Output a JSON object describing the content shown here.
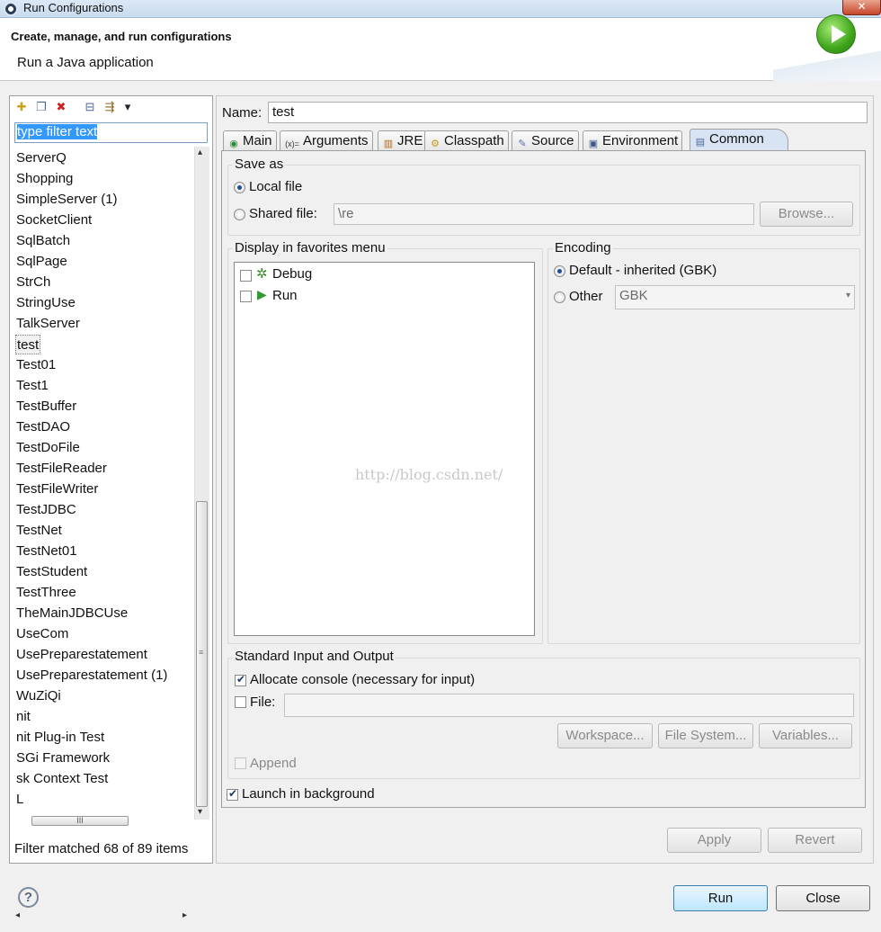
{
  "window": {
    "title": "Run Configurations",
    "close_glyph": "✕"
  },
  "header": {
    "title": "Create, manage, and run configurations",
    "subtitle": "Run a Java application",
    "icon": "run-large-icon"
  },
  "left": {
    "toolbar": [
      {
        "name": "new-config-icon",
        "glyph": "✚"
      },
      {
        "name": "duplicate-icon",
        "glyph": "❐"
      },
      {
        "name": "delete-icon",
        "glyph": "✖"
      },
      {
        "name": "collapse-all-icon",
        "glyph": "⊟"
      },
      {
        "name": "filter-icon",
        "glyph": "⇶"
      },
      {
        "name": "dropdown-arrow-icon",
        "glyph": "▾"
      }
    ],
    "filter_text": "type filter text",
    "items": [
      "ServerQ",
      "Shopping",
      "SimpleServer (1)",
      "SocketClient",
      "SqlBatch",
      "SqlPage",
      "StrCh",
      "StringUse",
      "TalkServer",
      "test",
      "Test01",
      "Test1",
      "TestBuffer",
      "TestDAO",
      "TestDoFile",
      "TestFileReader",
      "TestFileWriter",
      "TestJDBC",
      "TestNet",
      "TestNet01",
      "TestStudent",
      "TestThree",
      "TheMainJDBCUse",
      "UseCom",
      "UsePreparestatement",
      "UsePreparestatement (1)",
      "WuZiQi",
      "nit",
      "nit Plug-in Test",
      "SGi Framework",
      "sk Context Test",
      "L"
    ],
    "selected_index": 9,
    "hscroll_grip": "III",
    "scroll_up": "▴",
    "scroll_down": "▾",
    "scroll_left": "◂",
    "scroll_right": "▸",
    "filter_status": "Filter matched 68 of 89 items"
  },
  "right": {
    "name_label": "Name:",
    "name_value": "test",
    "tabs": [
      {
        "label": "Main",
        "icon": "main-tab-icon",
        "glyph": "◉",
        "color": "#2e8b3a"
      },
      {
        "label": "Arguments",
        "icon": "arguments-tab-icon",
        "glyph": "(x)=",
        "color": "#333333"
      },
      {
        "label": "JRE",
        "icon": "jre-tab-icon",
        "glyph": "▥",
        "color": "#b06a1a"
      },
      {
        "label": "Classpath",
        "icon": "classpath-tab-icon",
        "glyph": "⚙",
        "color": "#c49a1a"
      },
      {
        "label": "Source",
        "icon": "source-tab-icon",
        "glyph": "✎",
        "color": "#5a6fa5"
      },
      {
        "label": "Environment",
        "icon": "environment-tab-icon",
        "glyph": "▣",
        "color": "#3a5a8a"
      },
      {
        "label": "Common",
        "icon": "common-tab-icon",
        "glyph": "▤",
        "color": "#4a6a9a"
      }
    ],
    "active_tab": 6,
    "save_as": {
      "title": "Save as",
      "local_file": "Local file",
      "shared_file": "Shared file:",
      "shared_value": "\\re",
      "browse": "Browse..."
    },
    "favorites": {
      "title": "Display in favorites menu",
      "items": [
        {
          "label": "Debug",
          "icon": "debug-icon",
          "glyph": "✲",
          "color": "#3a8a2a"
        },
        {
          "label": "Run",
          "icon": "run-icon",
          "glyph": "▶",
          "color": "#2e9b2e"
        }
      ]
    },
    "encoding": {
      "title": "Encoding",
      "default": "Default - inherited (GBK)",
      "other": "Other",
      "other_value": "GBK"
    },
    "std_io": {
      "title": "Standard Input and Output",
      "allocate": "Allocate console (necessary for input)",
      "file": "File:",
      "workspace": "Workspace...",
      "file_system": "File System...",
      "variables": "Variables...",
      "append": "Append"
    },
    "launch_bg": "Launch in background",
    "apply": "Apply",
    "revert": "Revert"
  },
  "footer": {
    "help": "?",
    "run": "Run",
    "close": "Close"
  },
  "watermark": "http://blog.csdn.net/"
}
